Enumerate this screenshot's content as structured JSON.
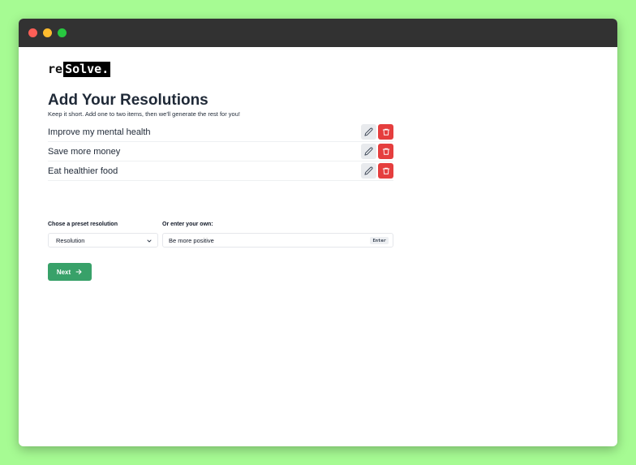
{
  "app": {
    "logo_prefix": "re",
    "logo_boxed": "Solve."
  },
  "header": {
    "title": "Add Your Resolutions",
    "subtitle": "Keep it short. Add one to two items, then we'll generate the rest for you!"
  },
  "resolutions": [
    {
      "text": "Improve my mental health"
    },
    {
      "text": "Save more money"
    },
    {
      "text": "Eat healthier food"
    }
  ],
  "form": {
    "preset_label": "Chose a preset resolution",
    "preset_value": "Resolution",
    "own_label": "Or enter your own:",
    "own_value": "Be more positive",
    "enter_key": "Enter"
  },
  "actions": {
    "next_label": "Next"
  },
  "icons": {
    "edit": "pencil-icon",
    "delete": "trash-icon",
    "select_chevron": "chevron-down-icon",
    "next_arrow": "arrow-right-icon"
  },
  "colors": {
    "page_bg": "#a6fb93",
    "titlebar": "#323232",
    "delete": "#e53e3e",
    "primary": "#38a169"
  }
}
